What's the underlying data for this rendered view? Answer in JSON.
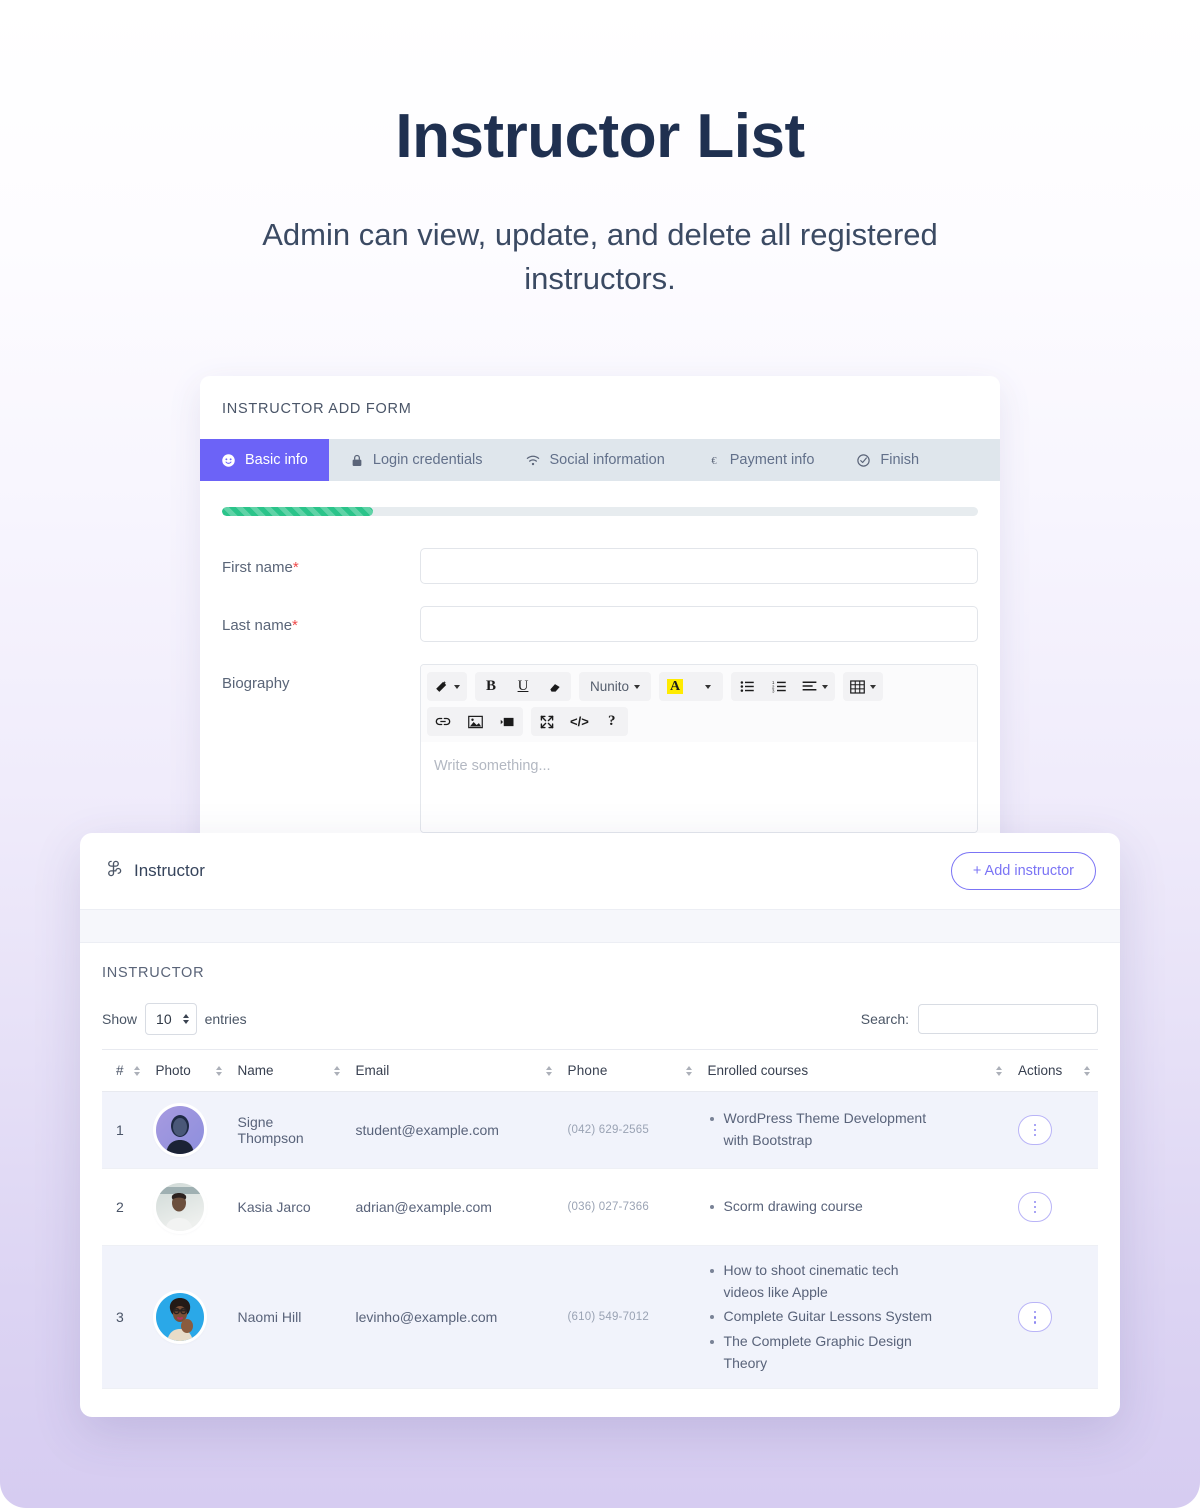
{
  "hero": {
    "title": "Instructor List",
    "subtitle": "Admin can view, update, and delete all registered instructors."
  },
  "form_card": {
    "title": "INSTRUCTOR ADD FORM",
    "tabs": [
      {
        "label": "Basic info",
        "icon": "smiley-circle-icon",
        "active": true
      },
      {
        "label": "Login credentials",
        "icon": "lock-icon",
        "active": false
      },
      {
        "label": "Social information",
        "icon": "wifi-icon",
        "active": false
      },
      {
        "label": "Payment info",
        "icon": "euro-icon",
        "active": false
      },
      {
        "label": "Finish",
        "icon": "check-circle-icon",
        "active": false
      }
    ],
    "progress_percent": 20,
    "progress_color": "#2bc48a",
    "fields": [
      {
        "label": "First name",
        "required": true,
        "value": "",
        "placeholder": ""
      },
      {
        "label": "Last name",
        "required": true,
        "value": "",
        "placeholder": ""
      },
      {
        "label": "Biography",
        "required": false
      }
    ],
    "editor": {
      "placeholder": "Write something...",
      "font_name": "Nunito",
      "toolbar_row1": [
        {
          "icon": "magic-wand-icon",
          "label": "",
          "caret": true
        },
        {
          "icon": "bold-icon",
          "label": "B",
          "caret": false
        },
        {
          "icon": "underline-icon",
          "label": "U",
          "caret": false
        },
        {
          "icon": "eraser-icon",
          "label": "",
          "caret": false
        },
        {
          "icon": "font-name-icon",
          "label": "Nunito",
          "caret": true
        },
        {
          "icon": "text-color-icon",
          "label": "A",
          "caret": false
        },
        {
          "icon": "text-color-caret-icon",
          "label": "",
          "caret": true
        },
        {
          "icon": "unordered-list-icon",
          "label": "",
          "caret": false
        },
        {
          "icon": "ordered-list-icon",
          "label": "",
          "caret": false
        },
        {
          "icon": "paragraph-align-icon",
          "label": "",
          "caret": true
        },
        {
          "icon": "table-icon",
          "label": "",
          "caret": true
        }
      ],
      "toolbar_row2": [
        {
          "icon": "link-icon",
          "label": "",
          "caret": false
        },
        {
          "icon": "picture-icon",
          "label": "",
          "caret": false
        },
        {
          "icon": "video-icon",
          "label": "",
          "caret": false
        },
        {
          "icon": "fullscreen-icon",
          "label": "",
          "caret": false
        },
        {
          "icon": "code-view-icon",
          "label": "</>",
          "caret": false
        },
        {
          "icon": "help-icon",
          "label": "?",
          "caret": false
        }
      ]
    }
  },
  "list_card": {
    "header_title": "Instructor",
    "header_icon": "command-grid-icon",
    "add_button": "+ Add instructor",
    "panel_title": "INSTRUCTOR",
    "show_label": "Show",
    "entries_value": "10",
    "entries_label": "entries",
    "search_label": "Search:",
    "search_value": "",
    "search_placeholder": "",
    "columns": [
      {
        "label": "#",
        "sortable": true
      },
      {
        "label": "Photo",
        "sortable": true
      },
      {
        "label": "Name",
        "sortable": true
      },
      {
        "label": "Email",
        "sortable": true
      },
      {
        "label": "Phone",
        "sortable": true
      },
      {
        "label": "Enrolled courses",
        "sortable": true
      },
      {
        "label": "Actions",
        "sortable": true
      }
    ],
    "rows": [
      {
        "index": "1",
        "avatar": "avatar-signe-thompson",
        "name": "Signe Thompson",
        "email": "student@example.com",
        "phone": "(042) 629-2565",
        "courses": [
          "WordPress Theme Development with Bootstrap"
        ]
      },
      {
        "index": "2",
        "avatar": "avatar-kasia-jarco",
        "name": "Kasia Jarco",
        "email": "adrian@example.com",
        "phone": "(036) 027-7366",
        "courses": [
          "Scorm drawing course"
        ]
      },
      {
        "index": "3",
        "avatar": "avatar-naomi-hill",
        "name": "Naomi Hill",
        "email": "levinho@example.com",
        "phone": "(610) 549-7012",
        "courses": [
          "How to shoot cinematic tech videos like Apple",
          "Complete Guitar Lessons System",
          "The Complete Graphic Design Theory"
        ]
      }
    ]
  },
  "colors": {
    "accent": "#6c63f7",
    "accent_soft": "#7b74f5",
    "progress": "#2bc48a",
    "title": "#1f3050",
    "required": "#ef4a4a",
    "row_odd": "#f1f3fb"
  }
}
